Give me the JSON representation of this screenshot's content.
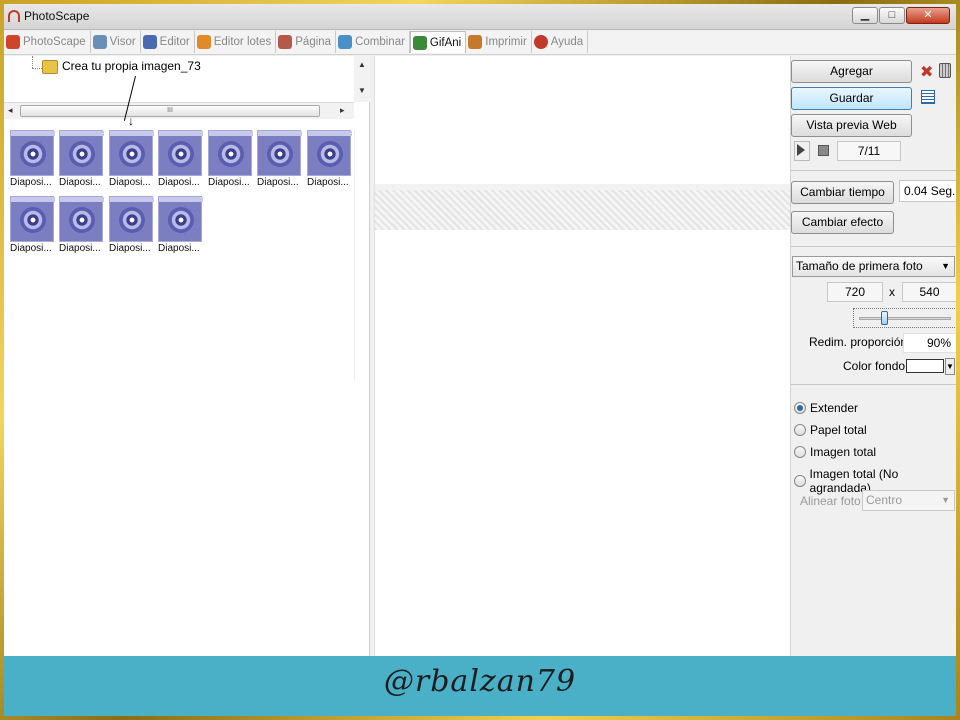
{
  "window": {
    "title": "PhotoScape",
    "controls": {
      "minimize": "▁",
      "maximize": "□",
      "close": "✕"
    }
  },
  "tabs": [
    {
      "label": "PhotoScape",
      "icon": "photoscape-icon",
      "color": "#d0442a"
    },
    {
      "label": "Visor",
      "icon": "viewer-icon",
      "color": "#6a8fb7"
    },
    {
      "label": "Editor",
      "icon": "editor-icon",
      "color": "#4a6ab0"
    },
    {
      "label": "Editor lotes",
      "icon": "batch-editor-icon",
      "color": "#e28a2a"
    },
    {
      "label": "Página",
      "icon": "page-icon",
      "color": "#b55a4a"
    },
    {
      "label": "Combinar",
      "icon": "combine-icon",
      "color": "#4a90c8"
    },
    {
      "label": "GifAni",
      "icon": "gifani-icon",
      "color": "#3a8a3a",
      "active": true
    },
    {
      "label": "Imprimir",
      "icon": "print-icon",
      "color": "#c47a2a"
    },
    {
      "label": "Ayuda",
      "icon": "help-icon",
      "color": "#c0392b"
    }
  ],
  "tree": {
    "folder_label": "Crea tu propia imagen_73",
    "scroll_grip": "III"
  },
  "thumbnails": [
    "Diaposi...",
    "Diaposi...",
    "Diaposi...",
    "Diaposi...",
    "Diaposi...",
    "Diaposi...",
    "Diaposi...",
    "Diaposi...",
    "Diaposi...",
    "Diaposi...",
    "Diaposi..."
  ],
  "right_panel": {
    "add_label": "Agregar",
    "save_label": "Guardar",
    "preview_label": "Vista previa Web",
    "frame_counter": "7/11",
    "change_time_label": "Cambiar tiempo",
    "time_value": "0.04 Seg.",
    "change_effect_label": "Cambiar efecto",
    "size_mode": "Tamaño de primera foto",
    "width": "720",
    "times": "x",
    "height": "540",
    "resize_label": "Redim. proporción",
    "resize_value": "90%",
    "bg_color_label": "Color fondo",
    "bg_color": "#ffffff",
    "fit_options": [
      {
        "label": "Extender",
        "checked": true
      },
      {
        "label": "Papel total",
        "checked": false
      },
      {
        "label": "Imagen total",
        "checked": false
      },
      {
        "label": "Imagen total (No agrandada)",
        "checked": false
      }
    ],
    "align_label": "Alinear foto",
    "align_value": "Centro"
  },
  "banner": {
    "text": "@rbalzan79",
    "color": "#4ab0c8"
  }
}
